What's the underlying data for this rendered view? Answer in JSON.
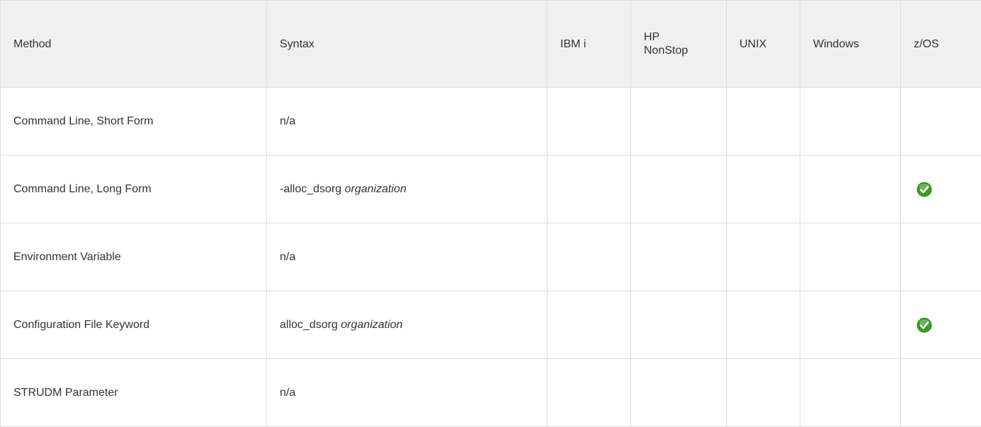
{
  "columns": [
    "Method",
    "Syntax",
    "IBM i",
    "HP NonStop",
    "UNIX",
    "Windows",
    "z/OS"
  ],
  "header_hp_line1": "HP",
  "header_hp_line2": "NonStop",
  "rows": [
    {
      "method": "Command Line, Short Form",
      "syntax_prefix": "n/a",
      "syntax_arg": "",
      "zos": false
    },
    {
      "method": "Command Line, Long Form",
      "syntax_prefix": "-alloc_dsorg ",
      "syntax_arg": "organization",
      "zos": true
    },
    {
      "method": "Environment Variable",
      "syntax_prefix": "n/a",
      "syntax_arg": "",
      "zos": false
    },
    {
      "method": "Configuration File Keyword",
      "syntax_prefix": "alloc_dsorg ",
      "syntax_arg": "organization",
      "zos": true
    },
    {
      "method": "STRUDM Parameter",
      "syntax_prefix": "n/a",
      "syntax_arg": "",
      "zos": false
    }
  ],
  "icons": {
    "supported": "check-circle-icon"
  },
  "colors": {
    "header_bg": "#f0f0f0",
    "border": "#dddddd",
    "check_green": "#3a9d23"
  }
}
